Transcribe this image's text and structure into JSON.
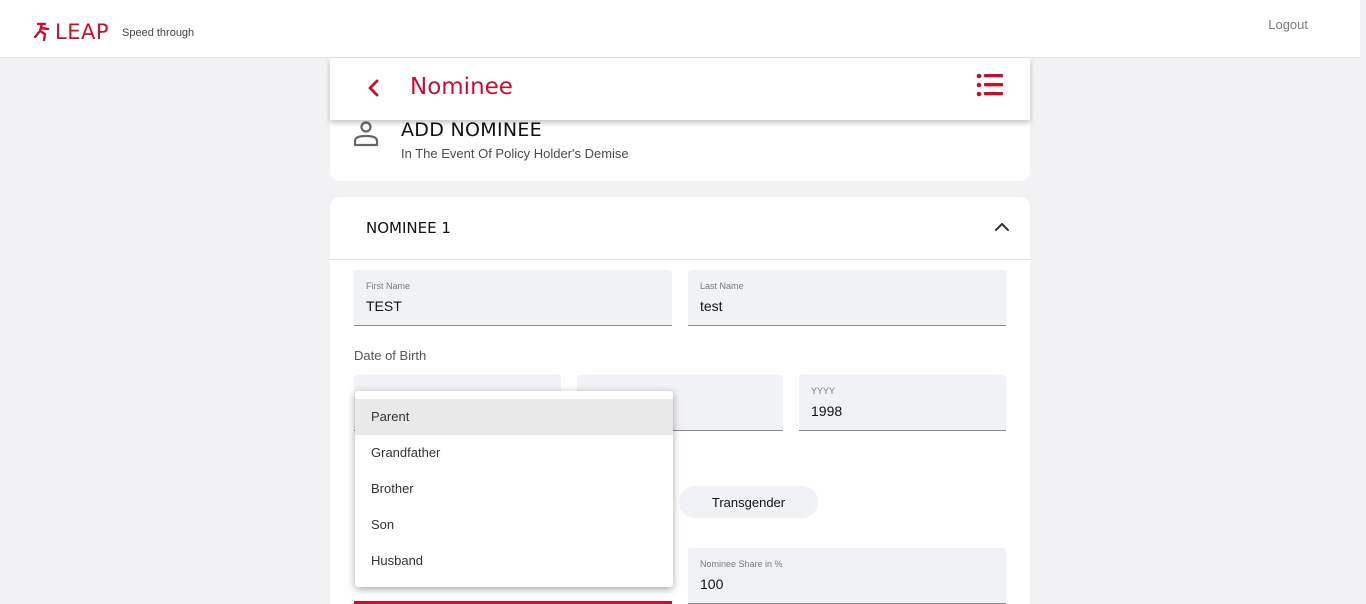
{
  "header": {
    "brand_name": "LEAP",
    "tagline": "Speed through",
    "logout_label": "Logout"
  },
  "page": {
    "title": "Nominee"
  },
  "add_section": {
    "title": "ADD NOMINEE",
    "subtitle": "In The Event Of Policy Holder's Demise"
  },
  "nominee": {
    "title": "NOMINEE 1",
    "first_name": {
      "label": "First Name",
      "value": "TEST"
    },
    "last_name": {
      "label": "Last Name",
      "value": "test"
    },
    "dob_label": "Date of Birth",
    "dob_year": {
      "label": "YYYY",
      "value": "1998"
    },
    "gender_option": "Transgender",
    "share": {
      "label": "Nominee Share in %",
      "value": "100"
    }
  },
  "relationship_dropdown": {
    "options": [
      "Parent",
      "Grandfather",
      "Brother",
      "Son",
      "Husband"
    ],
    "highlighted": "Parent"
  },
  "colors": {
    "brand": "#c8102e",
    "field_bg": "#f1f2f6",
    "page_bg": "#f2f2f4"
  }
}
